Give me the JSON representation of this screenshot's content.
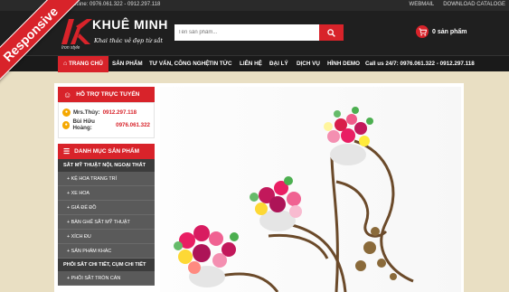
{
  "topbar": {
    "hotline": "Hotline: 0976.061.322 - 0912.297.118",
    "webmail": "WEBMAIL",
    "catalog": "DOWNLOAD CATALOGE"
  },
  "logo": {
    "brand": "KHUÊ MINH",
    "slogan": "Khai thác vẻ đẹp từ sắt",
    "sub": "Iron style"
  },
  "ribbon": "Responsive",
  "search": {
    "placeholder": "Tên sản phẩm..."
  },
  "cart": {
    "label": "0 sản phẩm"
  },
  "nav": {
    "home": "TRANG CHỦ",
    "items": [
      "SẢN PHẨM",
      "TƯ VẤN, CÔNG NGHỆ",
      "TIN TỨC",
      "LIÊN HỆ",
      "ĐẠI LÝ",
      "DỊCH VỤ",
      "HÌNH DEMO"
    ],
    "hotline": "Call us 24/7: 0976.061.322 - 0912.297.118"
  },
  "support": {
    "title": "HỖ TRỢ TRỰC TUYẾN",
    "contacts": [
      {
        "name": "Mrs.Thủy:",
        "phone": "0912.297.118"
      },
      {
        "name": "Bùi Hữu Hoàng:",
        "phone": "0976.061.322"
      }
    ]
  },
  "categories": {
    "title": "DANH MỤC SẢN PHẨM",
    "group1": "SẮT MỸ THUẬT NỘI, NGOẠI THẤT",
    "items": [
      "+ KỆ HOA TRANG TRÍ",
      "+ XE HOA",
      "+ GIÁ ĐỂ ĐỒ",
      "+ BÀN GHẾ SẮT MỸ THUẬT",
      "+ XÍCH ĐU",
      "+ SẢN PHẨM KHÁC"
    ],
    "group2": "PHÔI SẮT CHI TIẾT, CỤM CHI TIẾT",
    "items2": [
      "+ PHÔI SẮT TRÒN CÁN"
    ]
  },
  "colors": {
    "accent": "#d8232a",
    "dark": "#1f1f1f",
    "bg": "#e9dfc3"
  }
}
